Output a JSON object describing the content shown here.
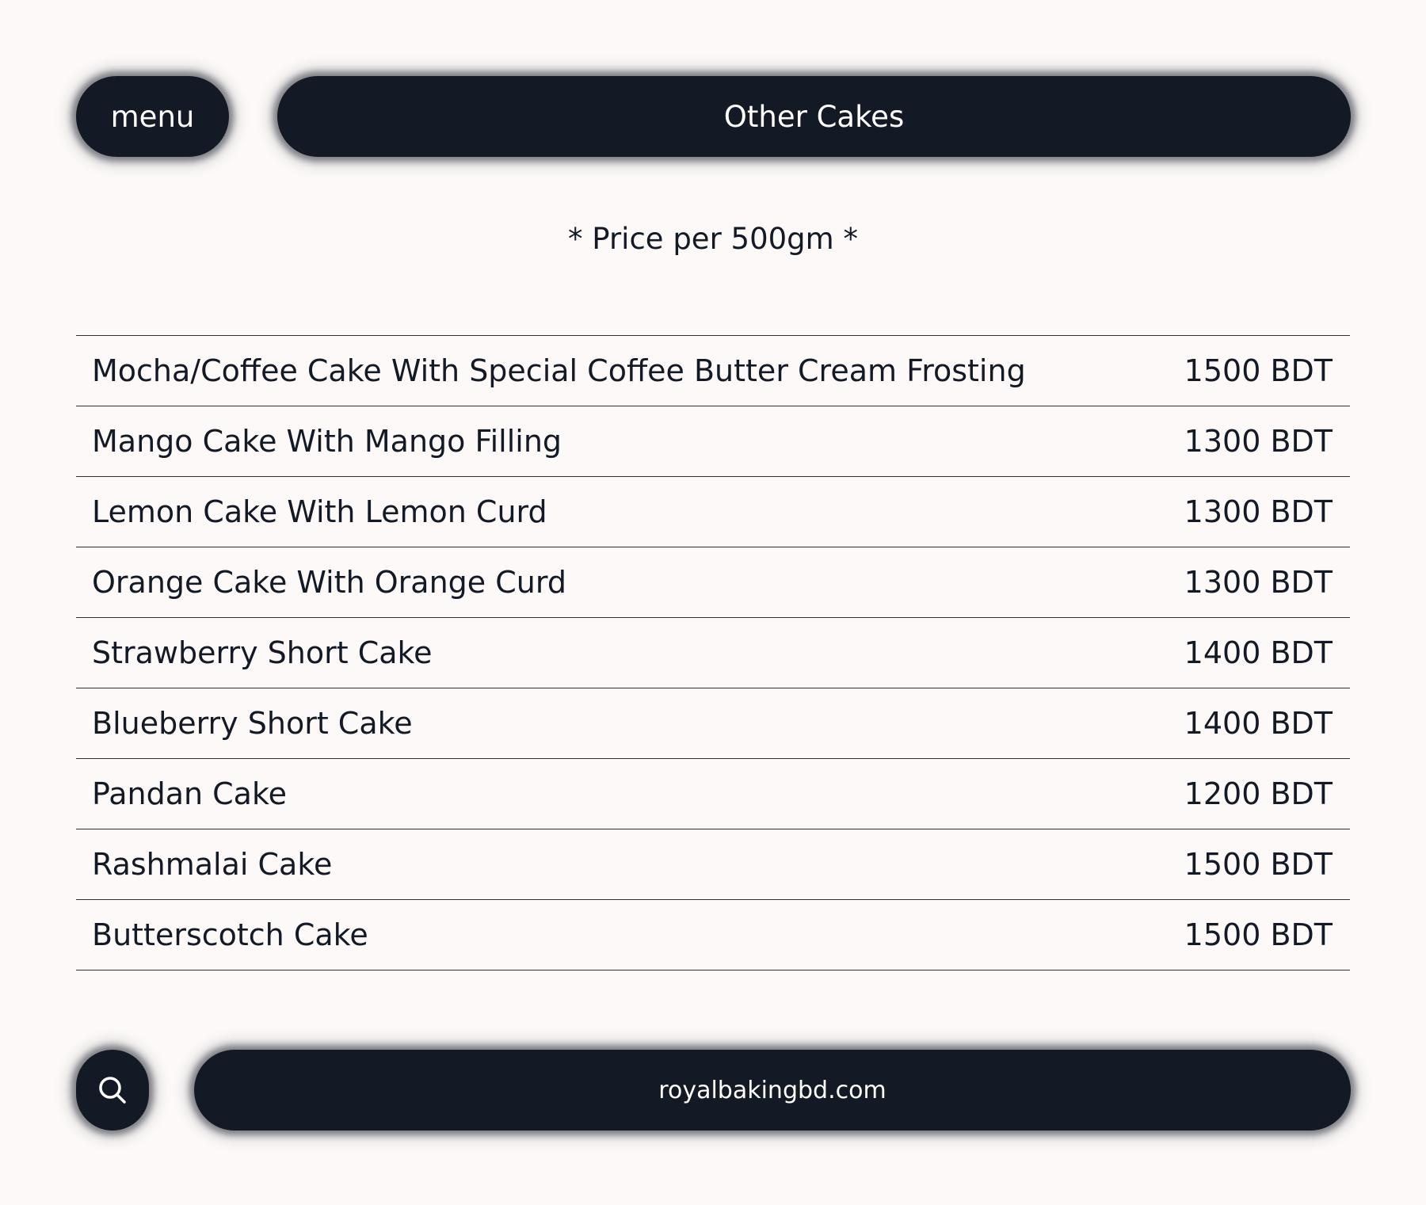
{
  "header": {
    "menu_label": "menu",
    "title": "Other Cakes"
  },
  "subtitle": "* Price per 500gm *",
  "items": [
    {
      "name": "Mocha/Coffee Cake With Special Coffee Butter Cream Frosting",
      "price": "1500 BDT"
    },
    {
      "name": "Mango Cake With Mango Filling",
      "price": "1300 BDT"
    },
    {
      "name": "Lemon Cake With Lemon Curd",
      "price": "1300 BDT"
    },
    {
      "name": "Orange Cake With Orange Curd",
      "price": "1300 BDT"
    },
    {
      "name": "Strawberry Short Cake",
      "price": "1400 BDT"
    },
    {
      "name": "Blueberry Short Cake",
      "price": "1400 BDT"
    },
    {
      "name": "Pandan Cake",
      "price": "1200 BDT"
    },
    {
      "name": "Rashmalai Cake",
      "price": "1500 BDT"
    },
    {
      "name": "Butterscotch Cake",
      "price": "1500 BDT"
    }
  ],
  "footer": {
    "search_icon": "search-icon",
    "url": "royalbakingbd.com"
  },
  "colors": {
    "background": "#fcf9f8",
    "pill": "#141a25",
    "text": "#141a25"
  }
}
